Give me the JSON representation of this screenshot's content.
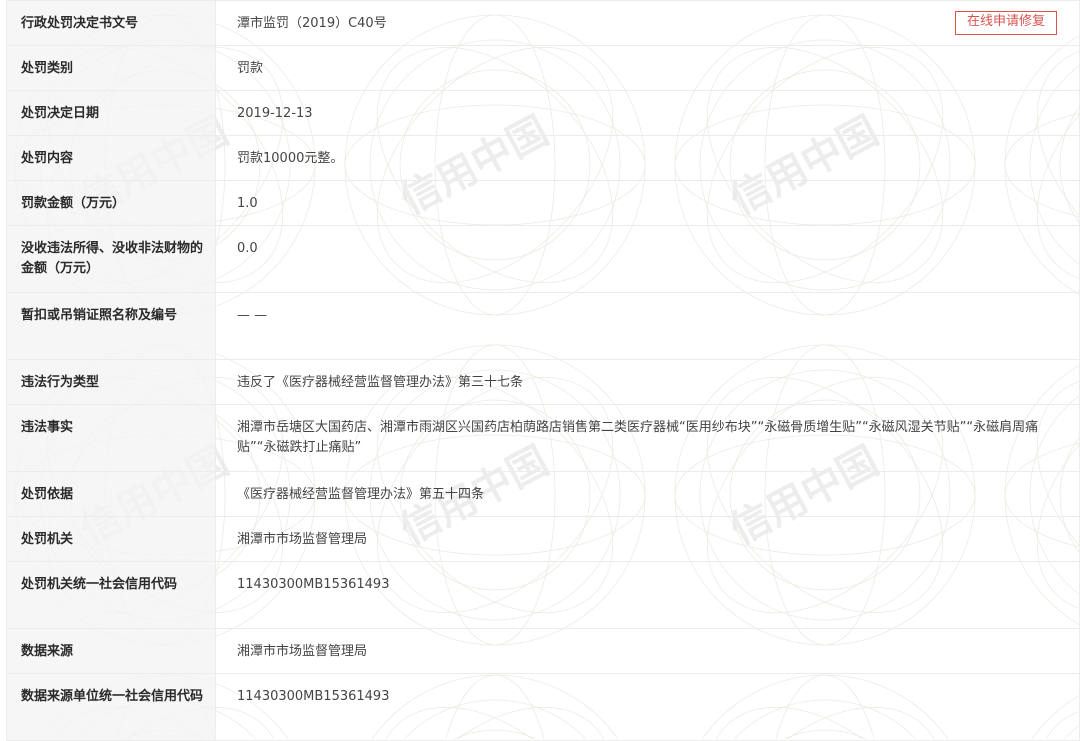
{
  "rows": [
    {
      "label": "行政处罚决定书文号",
      "value": "潭市监罚（2019）C40号"
    },
    {
      "label": "处罚类别",
      "value": "罚款"
    },
    {
      "label": "处罚决定日期",
      "value": "2019-12-13"
    },
    {
      "label": "处罚内容",
      "value": "罚款10000元整。"
    },
    {
      "label": "罚款金额（万元）",
      "value": "1.0"
    },
    {
      "label": "没收违法所得、没收非法财物的金额（万元）",
      "value": "0.0"
    },
    {
      "label": "暂扣或吊销证照名称及编号",
      "value": "— —"
    },
    {
      "label": "违法行为类型",
      "value": "违反了《医疗器械经营监督管理办法》第三十七条"
    },
    {
      "label": "违法事实",
      "value": "湘潭市岳塘区大国药店、湘潭市雨湖区兴国药店柏荫路店销售第二类医疗器械“医用纱布块”“永磁骨质增生贴”“永磁风湿关节贴”“永磁肩周痛贴”“永磁跌打止痛贴”"
    },
    {
      "label": "处罚依据",
      "value": "《医疗器械经营监督管理办法》第五十四条"
    },
    {
      "label": "处罚机关",
      "value": "湘潭市市场监督管理局"
    },
    {
      "label": "处罚机关统一社会信用代码",
      "value": "11430300MB15361493"
    },
    {
      "label": "数据来源",
      "value": "湘潭市市场监督管理局"
    },
    {
      "label": "数据来源单位统一社会信用代码",
      "value": "11430300MB15361493"
    }
  ],
  "repair_button_label": "在线申请修复",
  "watermark_text": "信用中国",
  "colors": {
    "accent": "#d9534f",
    "label_bg": "#f4f4f4",
    "border": "#ececec"
  }
}
